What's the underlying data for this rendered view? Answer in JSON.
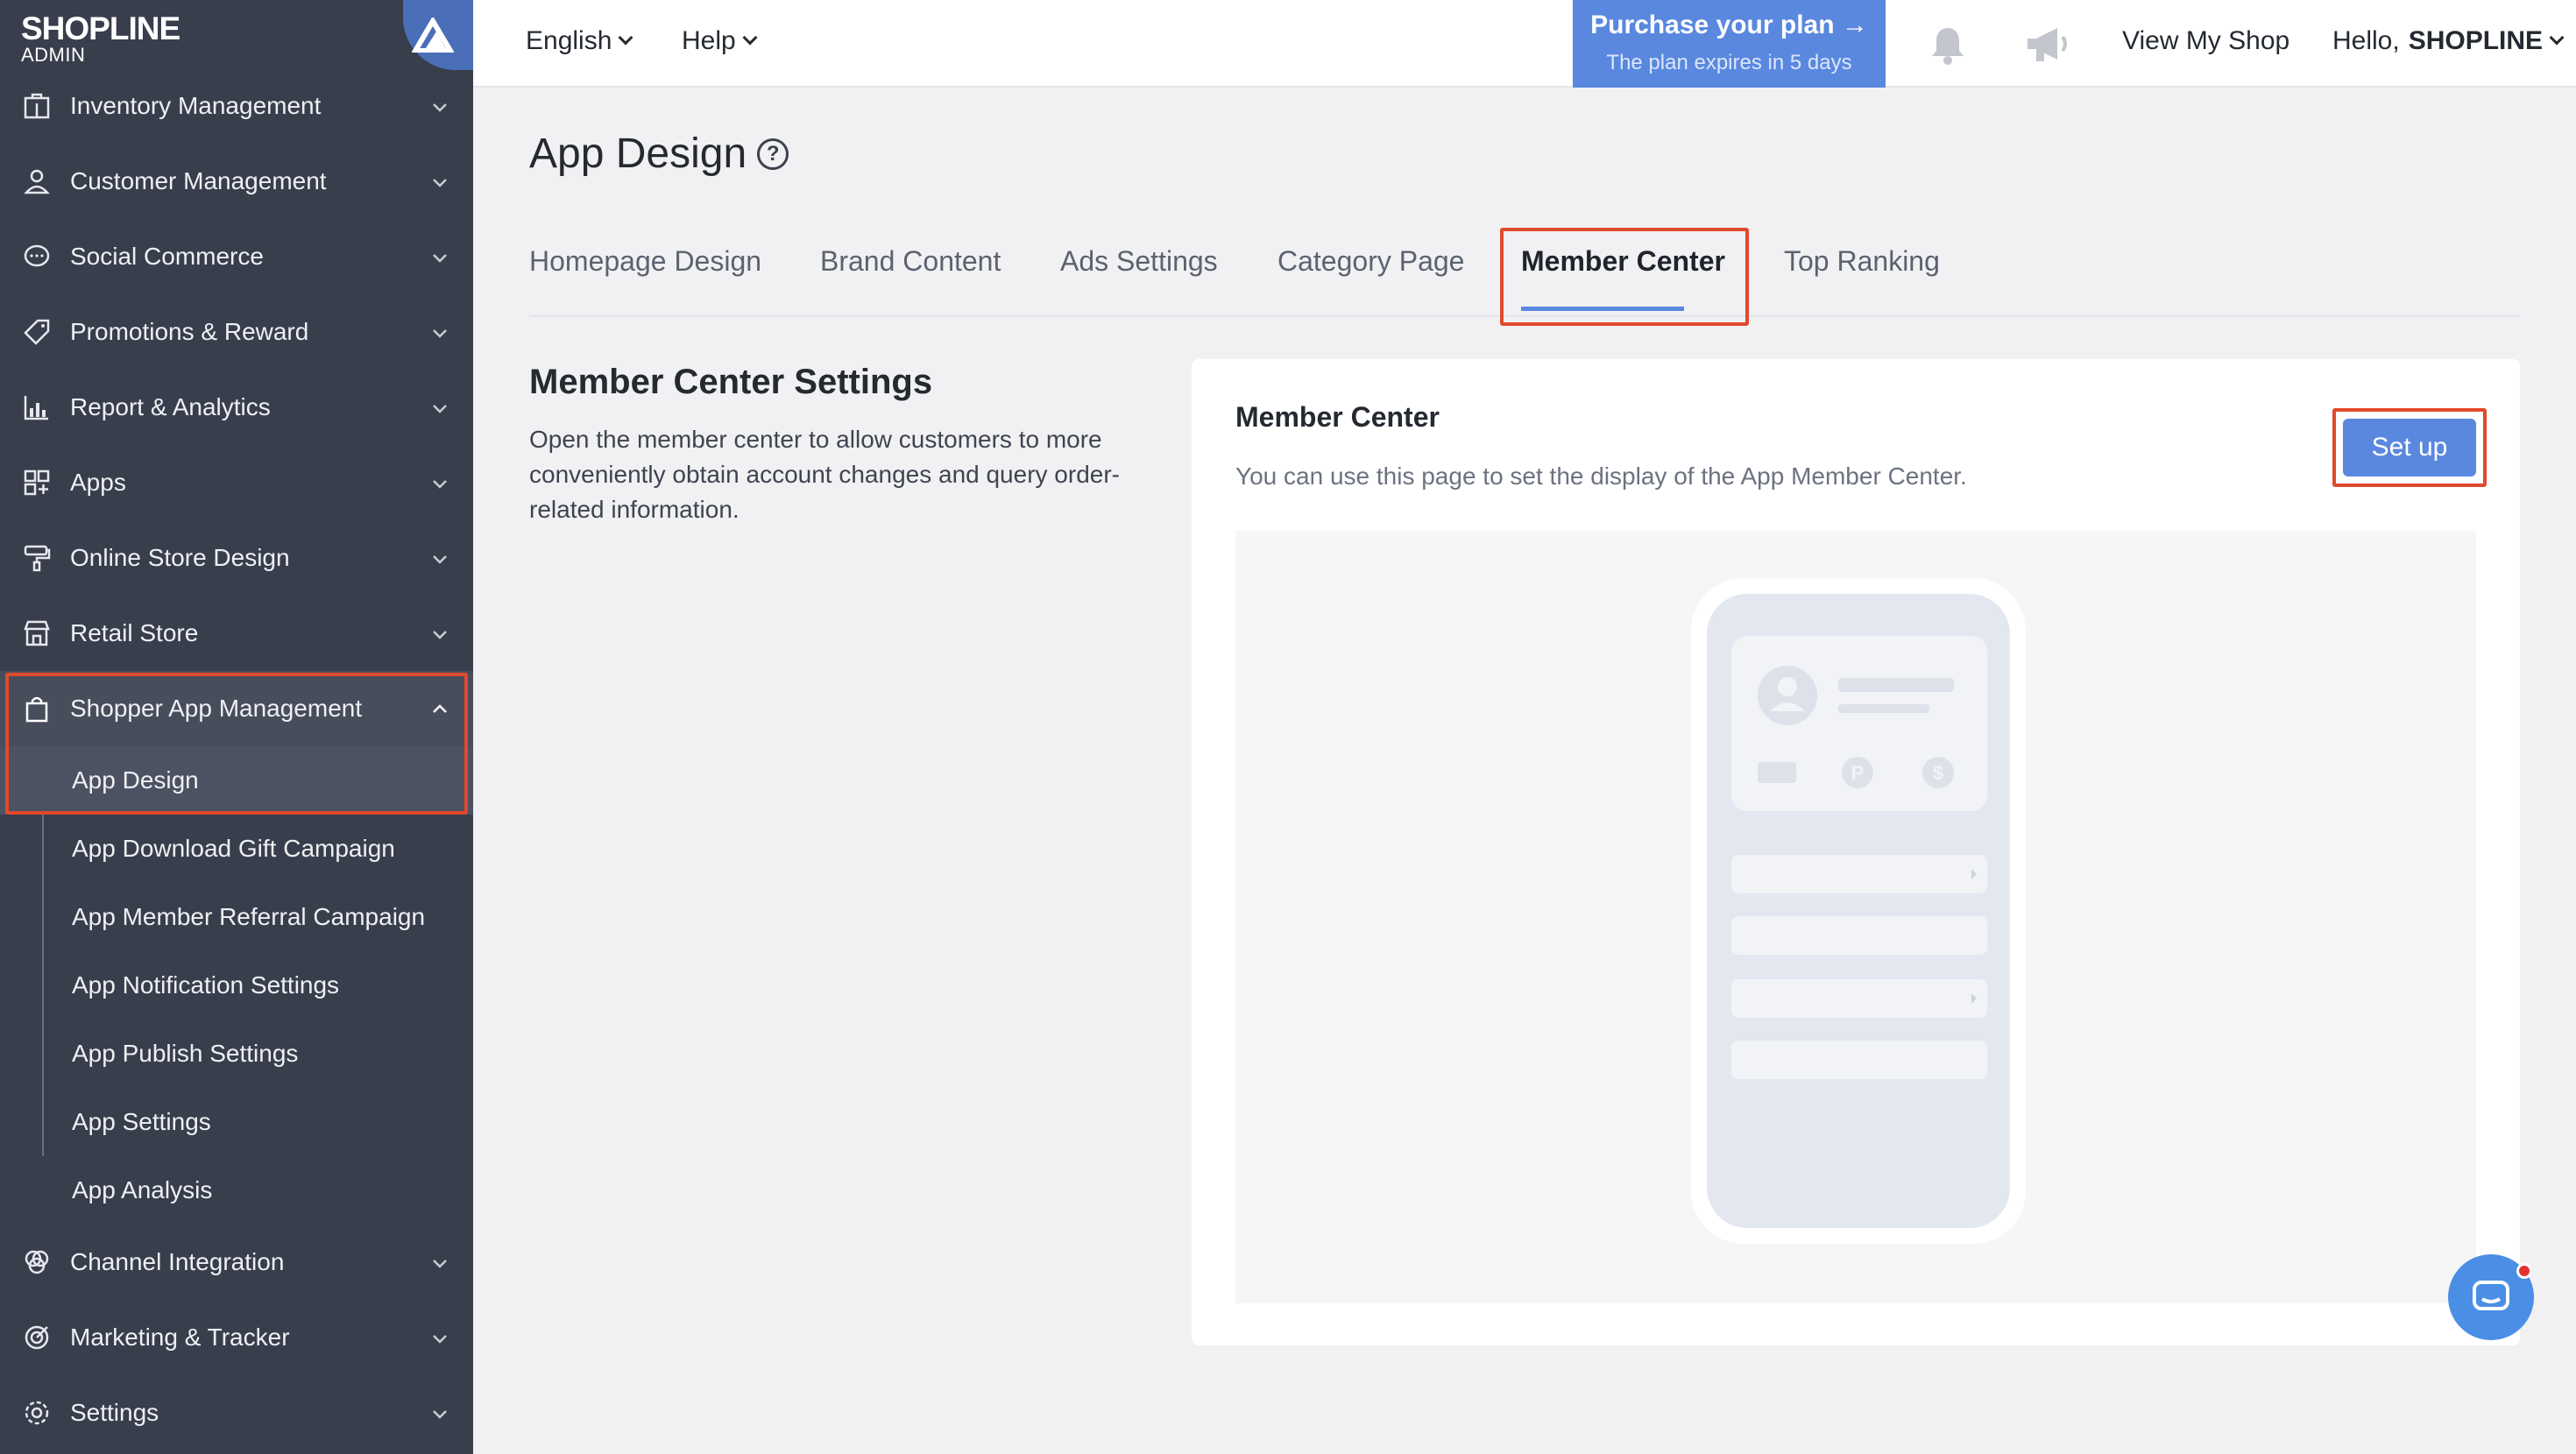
{
  "brand": {
    "logo": "SHOPLINE",
    "sub": "ADMIN"
  },
  "sidebar": {
    "items_top": [
      {
        "label": "Inventory Management",
        "icon": "inventory-icon"
      },
      {
        "label": "Customer Management",
        "icon": "customer-icon"
      },
      {
        "label": "Social Commerce",
        "icon": "chat-bubble-icon"
      },
      {
        "label": "Promotions & Reward",
        "icon": "tag-icon"
      },
      {
        "label": "Report & Analytics",
        "icon": "bar-chart-icon"
      },
      {
        "label": "Apps",
        "icon": "apps-grid-icon"
      },
      {
        "label": "Online Store Design",
        "icon": "paint-roller-icon"
      },
      {
        "label": "Retail Store",
        "icon": "store-icon"
      }
    ],
    "open_item": {
      "label": "Shopper App Management",
      "icon": "shopping-bag-icon"
    },
    "sub_items": [
      "App Design",
      "App Download Gift Campaign",
      "App Member Referral Campaign",
      "App Notification Settings",
      "App Publish Settings",
      "App Settings",
      "App Analysis"
    ],
    "items_bottom": [
      {
        "label": "Channel Integration",
        "icon": "channel-icon"
      },
      {
        "label": "Marketing & Tracker",
        "icon": "target-icon"
      },
      {
        "label": "Settings",
        "icon": "gear-icon"
      }
    ]
  },
  "topbar": {
    "language": "English",
    "help": "Help",
    "plan_title": "Purchase your plan →",
    "plan_sub": "The plan expires in 5 days",
    "view_shop": "View My Shop",
    "greeting": "Hello,",
    "shop_name": "SHOPLINE"
  },
  "main": {
    "title": "App Design",
    "help_glyph": "?",
    "tabs": [
      "Homepage Design",
      "Brand Content",
      "Ads Settings",
      "Category Page",
      "Member Center",
      "Top Ranking"
    ],
    "active_tab": "Member Center",
    "section_title": "Member Center Settings",
    "section_desc": "Open the member center to allow customers to more conveniently obtain account changes and query order-related information.",
    "card_title": "Member Center",
    "card_desc": "You can use this page to set the display of the App Member Center.",
    "setup_label": "Set up"
  },
  "colors": {
    "accent": "#5a88df",
    "highlight": "#e04a2c",
    "sidebar": "#383e4c"
  }
}
